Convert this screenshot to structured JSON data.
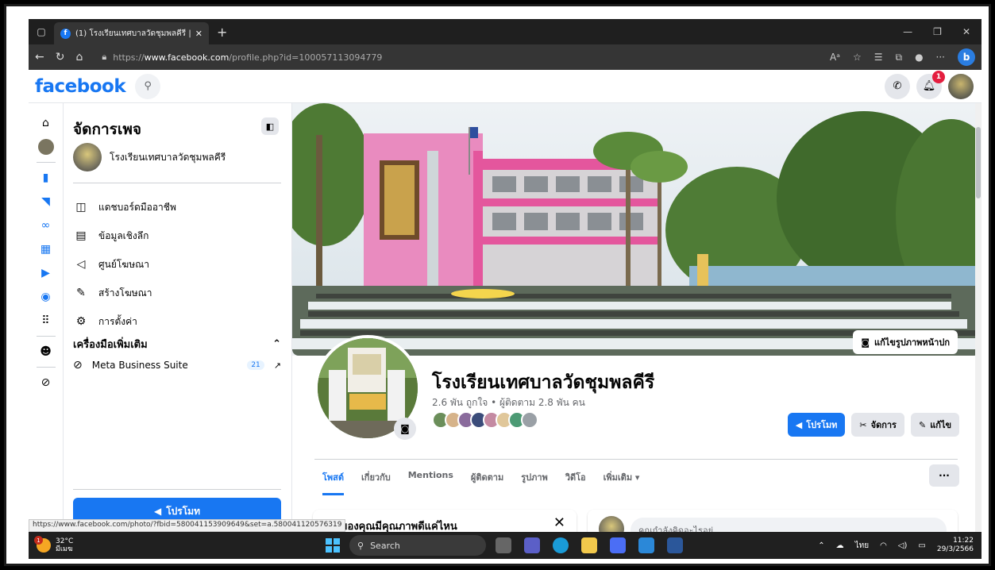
{
  "browser": {
    "tab_title": "(1) โรงเรียนเทศบาลวัดชุมพลคีรี | Face",
    "url_prefix": "https://",
    "url_host": "www.facebook.com",
    "url_path": "/profile.php?id=100057113094779"
  },
  "fb": {
    "logo": "facebook",
    "notification_count": "1"
  },
  "panel": {
    "title": "จัดการเพจ",
    "page_name": "โรงเรียนเทศบาลวัดชุมพลคีรี",
    "menu": [
      {
        "label": "แดชบอร์ดมืออาชีพ",
        "icon": "dashboard-icon"
      },
      {
        "label": "ข้อมูลเชิงลึก",
        "icon": "insights-icon"
      },
      {
        "label": "ศูนย์โฆษณา",
        "icon": "megaphone-icon"
      },
      {
        "label": "สร้างโฆษณา",
        "icon": "pencil-icon"
      },
      {
        "label": "การตั้งค่า",
        "icon": "gear-icon"
      }
    ],
    "tools_heading": "เครื่องมือเพิ่มเติม",
    "mbs_label": "Meta Business Suite",
    "mbs_count": "21",
    "promote_label": "โปรโมท"
  },
  "profile": {
    "edit_cover": "แก้ไขรูปภาพหน้าปก",
    "name": "โรงเรียนเทศบาลวัดชุมพลคีรี",
    "stats": "2.6 พัน ถูกใจ • ผู้ติดตาม 2.8 พัน คน",
    "btn_promote": "โปรโมท",
    "btn_manage": "จัดการ",
    "btn_edit": "แก้ไข",
    "tabs": [
      "โพสต์",
      "เกี่ยวกับ",
      "Mentions",
      "ผู้ติดตาม",
      "รูปภาพ",
      "วิดีโอ",
      "เพิ่มเติม ▾"
    ],
    "more": "···"
  },
  "cards": {
    "quality_title": "เพจของคุณมีคุณภาพดีแค่ไหน",
    "composer_placeholder": "คุณกำลังคิดอะไรอยู่"
  },
  "status_url": "https://www.facebook.com/photo/?fbid=580041153909649&set=a.580041120576319",
  "taskbar": {
    "temp": "32°C",
    "weather": "มีเมฆ",
    "search": "Search",
    "lang": "ไทย",
    "time": "11:22",
    "date": "29/3/2566"
  }
}
